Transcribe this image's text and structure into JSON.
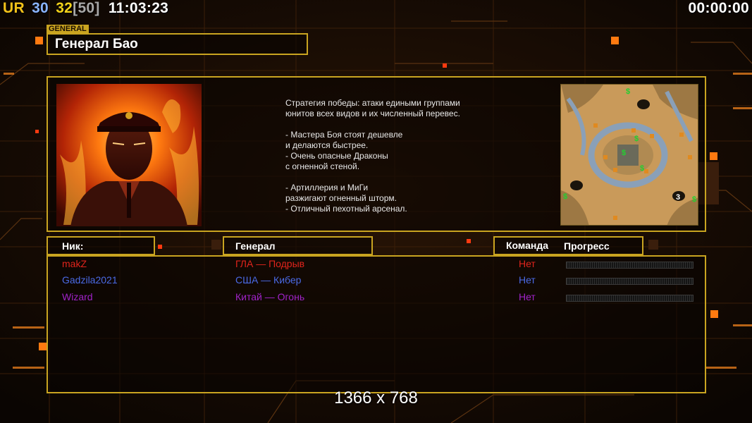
{
  "hud": {
    "prefix": "UR",
    "fps_a": "30",
    "fps_b": "32",
    "fps_cap": "[50]",
    "clock": "11:03:23",
    "timer": "00:00:00"
  },
  "general": {
    "tag": "GENERAL",
    "name": "Генерал Бао",
    "description_lines": [
      "Стратегия победы: атаки едиными группами",
      "юнитов всех видов и их численный перевес.",
      "",
      "- Мастера Боя стоят дешевле",
      "и делаются быстрее.",
      "- Очень опасные Драконы",
      "с огненной стеной.",
      "",
      "- Артиллерия и МиГи",
      "разжигают огненный шторм.",
      "- Отличный пехотный арсенал."
    ]
  },
  "minimap": {
    "start_marker": "3",
    "money_symbol": "$"
  },
  "columns": {
    "nick": "Ник:",
    "general": "Генерал",
    "team": "Команда",
    "progress": "Прогресс"
  },
  "players": [
    {
      "nick": "makZ",
      "general": "ГЛА — Подрыв",
      "team": "Нет",
      "color": "#e0241c",
      "progress": 0
    },
    {
      "nick": "Gadzila2021",
      "general": "США — Кибер",
      "team": "Нет",
      "color": "#4a6ae6",
      "progress": 0
    },
    {
      "nick": "Wizard",
      "general": "Китай — Огонь",
      "team": "Нет",
      "color": "#a023c8",
      "progress": 0
    }
  ],
  "resolution": "1366 x 768",
  "colors": {
    "frame": "#c9a420",
    "accent_orange": "#ff7a10",
    "hud_prefix": "#f2c21a",
    "hud_fps_a": "#8ab4ff",
    "hud_fps_b": "#f2d21a",
    "hud_fps_cap": "#a8a8a8"
  }
}
